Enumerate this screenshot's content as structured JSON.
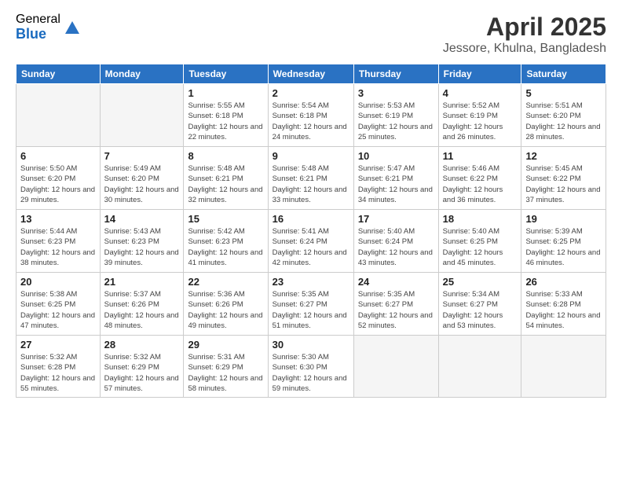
{
  "logo": {
    "general": "General",
    "blue": "Blue"
  },
  "title": "April 2025",
  "subtitle": "Jessore, Khulna, Bangladesh",
  "days_of_week": [
    "Sunday",
    "Monday",
    "Tuesday",
    "Wednesday",
    "Thursday",
    "Friday",
    "Saturday"
  ],
  "weeks": [
    [
      {
        "day": "",
        "info": ""
      },
      {
        "day": "",
        "info": ""
      },
      {
        "day": "1",
        "info": "Sunrise: 5:55 AM\nSunset: 6:18 PM\nDaylight: 12 hours and 22 minutes."
      },
      {
        "day": "2",
        "info": "Sunrise: 5:54 AM\nSunset: 6:18 PM\nDaylight: 12 hours and 24 minutes."
      },
      {
        "day": "3",
        "info": "Sunrise: 5:53 AM\nSunset: 6:19 PM\nDaylight: 12 hours and 25 minutes."
      },
      {
        "day": "4",
        "info": "Sunrise: 5:52 AM\nSunset: 6:19 PM\nDaylight: 12 hours and 26 minutes."
      },
      {
        "day": "5",
        "info": "Sunrise: 5:51 AM\nSunset: 6:20 PM\nDaylight: 12 hours and 28 minutes."
      }
    ],
    [
      {
        "day": "6",
        "info": "Sunrise: 5:50 AM\nSunset: 6:20 PM\nDaylight: 12 hours and 29 minutes."
      },
      {
        "day": "7",
        "info": "Sunrise: 5:49 AM\nSunset: 6:20 PM\nDaylight: 12 hours and 30 minutes."
      },
      {
        "day": "8",
        "info": "Sunrise: 5:48 AM\nSunset: 6:21 PM\nDaylight: 12 hours and 32 minutes."
      },
      {
        "day": "9",
        "info": "Sunrise: 5:48 AM\nSunset: 6:21 PM\nDaylight: 12 hours and 33 minutes."
      },
      {
        "day": "10",
        "info": "Sunrise: 5:47 AM\nSunset: 6:21 PM\nDaylight: 12 hours and 34 minutes."
      },
      {
        "day": "11",
        "info": "Sunrise: 5:46 AM\nSunset: 6:22 PM\nDaylight: 12 hours and 36 minutes."
      },
      {
        "day": "12",
        "info": "Sunrise: 5:45 AM\nSunset: 6:22 PM\nDaylight: 12 hours and 37 minutes."
      }
    ],
    [
      {
        "day": "13",
        "info": "Sunrise: 5:44 AM\nSunset: 6:23 PM\nDaylight: 12 hours and 38 minutes."
      },
      {
        "day": "14",
        "info": "Sunrise: 5:43 AM\nSunset: 6:23 PM\nDaylight: 12 hours and 39 minutes."
      },
      {
        "day": "15",
        "info": "Sunrise: 5:42 AM\nSunset: 6:23 PM\nDaylight: 12 hours and 41 minutes."
      },
      {
        "day": "16",
        "info": "Sunrise: 5:41 AM\nSunset: 6:24 PM\nDaylight: 12 hours and 42 minutes."
      },
      {
        "day": "17",
        "info": "Sunrise: 5:40 AM\nSunset: 6:24 PM\nDaylight: 12 hours and 43 minutes."
      },
      {
        "day": "18",
        "info": "Sunrise: 5:40 AM\nSunset: 6:25 PM\nDaylight: 12 hours and 45 minutes."
      },
      {
        "day": "19",
        "info": "Sunrise: 5:39 AM\nSunset: 6:25 PM\nDaylight: 12 hours and 46 minutes."
      }
    ],
    [
      {
        "day": "20",
        "info": "Sunrise: 5:38 AM\nSunset: 6:25 PM\nDaylight: 12 hours and 47 minutes."
      },
      {
        "day": "21",
        "info": "Sunrise: 5:37 AM\nSunset: 6:26 PM\nDaylight: 12 hours and 48 minutes."
      },
      {
        "day": "22",
        "info": "Sunrise: 5:36 AM\nSunset: 6:26 PM\nDaylight: 12 hours and 49 minutes."
      },
      {
        "day": "23",
        "info": "Sunrise: 5:35 AM\nSunset: 6:27 PM\nDaylight: 12 hours and 51 minutes."
      },
      {
        "day": "24",
        "info": "Sunrise: 5:35 AM\nSunset: 6:27 PM\nDaylight: 12 hours and 52 minutes."
      },
      {
        "day": "25",
        "info": "Sunrise: 5:34 AM\nSunset: 6:27 PM\nDaylight: 12 hours and 53 minutes."
      },
      {
        "day": "26",
        "info": "Sunrise: 5:33 AM\nSunset: 6:28 PM\nDaylight: 12 hours and 54 minutes."
      }
    ],
    [
      {
        "day": "27",
        "info": "Sunrise: 5:32 AM\nSunset: 6:28 PM\nDaylight: 12 hours and 55 minutes."
      },
      {
        "day": "28",
        "info": "Sunrise: 5:32 AM\nSunset: 6:29 PM\nDaylight: 12 hours and 57 minutes."
      },
      {
        "day": "29",
        "info": "Sunrise: 5:31 AM\nSunset: 6:29 PM\nDaylight: 12 hours and 58 minutes."
      },
      {
        "day": "30",
        "info": "Sunrise: 5:30 AM\nSunset: 6:30 PM\nDaylight: 12 hours and 59 minutes."
      },
      {
        "day": "",
        "info": ""
      },
      {
        "day": "",
        "info": ""
      },
      {
        "day": "",
        "info": ""
      }
    ]
  ]
}
